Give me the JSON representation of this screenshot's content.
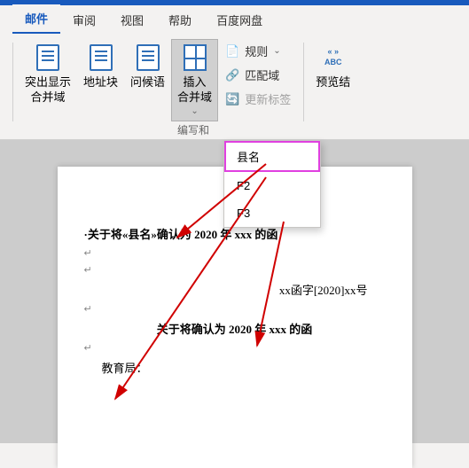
{
  "tabs": {
    "t0": "邮件",
    "t1": "审阅",
    "t2": "视图",
    "t3": "帮助",
    "t4": "百度网盘"
  },
  "ribbon": {
    "highlight": "突出显示\n合并域",
    "addrblock": "地址块",
    "greeting": "问候语",
    "insertfield": "插入\n合并域",
    "rules": "规则",
    "match": "匹配域",
    "update": "更新标签",
    "abc": "ABC",
    "preview": "预览结",
    "grouplabel": "编写和"
  },
  "menu": {
    "m0": "县名",
    "m1": "F2",
    "m2": "F3"
  },
  "doc": {
    "line1": "·关于将«县名»确认为 2020 年 xxx 的函",
    "line2": "xx函字[2020]xx号",
    "line3": "关于将确认为 2020 年 xxx 的函",
    "line4": "教育局：",
    "ret": "↵"
  }
}
